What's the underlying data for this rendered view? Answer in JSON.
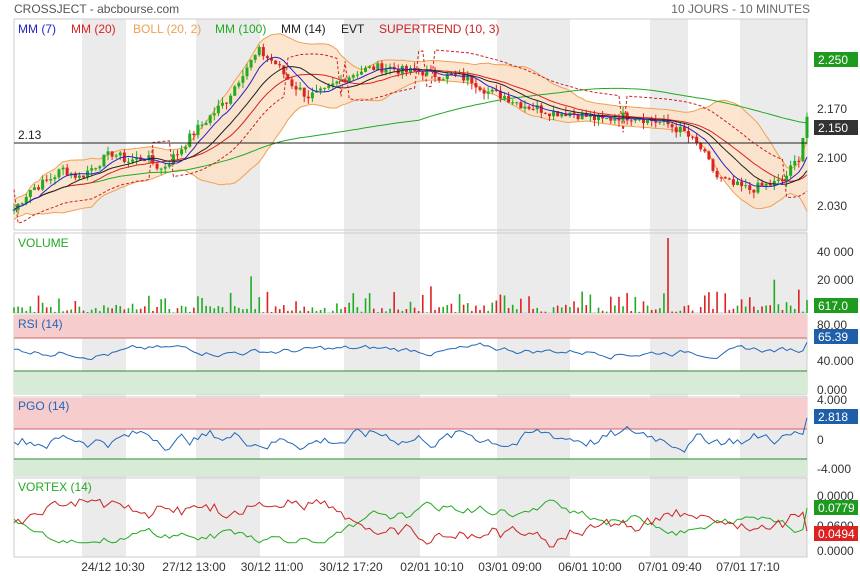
{
  "header": {
    "title": "CROSSJECT - abcbourse.com",
    "period": "10 JOURS - 10 MINUTES"
  },
  "colors": {
    "mm7": "#2222cc",
    "mm20": "#dd2222",
    "boll": "#f0a050",
    "boll_fill": "#fbe2c8",
    "mm100": "#22aa22",
    "mm14": "#222222",
    "supertrend": "#cc2222",
    "up": "#22aa22",
    "down": "#dd2222",
    "band": "#ebebeb",
    "rsi_line": "#2266bb",
    "overbought": "#f6cccc",
    "oversold": "#d6ecd6",
    "green_badge": "#1e9a1e",
    "blue_badge": "#1f5ea8",
    "red_badge": "#dd2222"
  },
  "chart_data": {
    "type": "candlestick-stock-chart",
    "title": "CROSSJECT - abcbourse.com",
    "subtitle": "10 JOURS - 10 MINUTES",
    "x_labels": [
      "24/12 10:30",
      "27/12 13:00",
      "30/12 11:00",
      "30/12 17:20",
      "02/01 10:10",
      "03/01 09:00",
      "06/01 10:00",
      "07/01 09:40",
      "07/01 17:10"
    ],
    "price": {
      "legend": [
        "MM (7)",
        "MM (20)",
        "BOLL (20, 2)",
        "MM (100)",
        "MM (14)",
        "EVT",
        "SUPERTREND (10, 3)"
      ],
      "ylim": [
        2.01,
        2.27
      ],
      "yticks": [
        "2.250",
        "2.170",
        "2.150",
        "2.100",
        "2.030"
      ],
      "horizontal_line": {
        "value": 2.13,
        "label": "2.13"
      },
      "last_value_label": "2.250",
      "current_value_label": "2.150",
      "close_path": [
        [
          0,
          2.035
        ],
        [
          4,
          2.06
        ],
        [
          8,
          2.07
        ],
        [
          12,
          2.085
        ],
        [
          16,
          2.075
        ],
        [
          20,
          2.09
        ],
        [
          24,
          2.105
        ],
        [
          28,
          2.095
        ],
        [
          32,
          2.1
        ],
        [
          36,
          2.085
        ],
        [
          40,
          2.105
        ],
        [
          44,
          2.13
        ],
        [
          48,
          2.15
        ],
        [
          52,
          2.17
        ],
        [
          56,
          2.205
        ],
        [
          60,
          2.23
        ],
        [
          64,
          2.215
        ],
        [
          68,
          2.19
        ],
        [
          72,
          2.175
        ],
        [
          76,
          2.18
        ],
        [
          80,
          2.195
        ],
        [
          84,
          2.205
        ],
        [
          88,
          2.21
        ],
        [
          92,
          2.21
        ],
        [
          96,
          2.205
        ],
        [
          100,
          2.205
        ],
        [
          104,
          2.2
        ],
        [
          108,
          2.2
        ],
        [
          112,
          2.195
        ],
        [
          116,
          2.18
        ],
        [
          120,
          2.175
        ],
        [
          124,
          2.165
        ],
        [
          128,
          2.16
        ],
        [
          132,
          2.155
        ],
        [
          136,
          2.155
        ],
        [
          140,
          2.15
        ],
        [
          144,
          2.145
        ],
        [
          148,
          2.15
        ],
        [
          152,
          2.15
        ],
        [
          156,
          2.145
        ],
        [
          160,
          2.14
        ],
        [
          164,
          2.13
        ],
        [
          168,
          2.11
        ],
        [
          172,
          2.075
        ],
        [
          176,
          2.065
        ],
        [
          180,
          2.06
        ],
        [
          184,
          2.065
        ],
        [
          188,
          2.07
        ],
        [
          192,
          2.1
        ],
        [
          194,
          2.15
        ]
      ]
    },
    "volume": {
      "label": "VOLUME",
      "yticks": [
        "40 000",
        "20 000",
        "0"
      ],
      "ylim": [
        0,
        48000
      ],
      "last_value_label": "617.0"
    },
    "rsi": {
      "label": "RSI (14)",
      "yticks": [
        "80.00",
        "40.000",
        "0.000"
      ],
      "ylim": [
        0,
        100
      ],
      "overbought": 70,
      "oversold": 30,
      "last_value_label": "65.39"
    },
    "pgo": {
      "label": "PGO (14)",
      "yticks": [
        "4.000",
        "0",
        "-4.000"
      ],
      "ylim": [
        -6,
        6
      ],
      "upper": 3,
      "lower": -3,
      "last_value_label": "2.818"
    },
    "vortex": {
      "label": "VORTEX (14)",
      "yticks": [
        "0.0000",
        "0.0600",
        "0.0000"
      ],
      "last_value_labels": [
        "0.0779",
        "0.0494"
      ]
    }
  }
}
